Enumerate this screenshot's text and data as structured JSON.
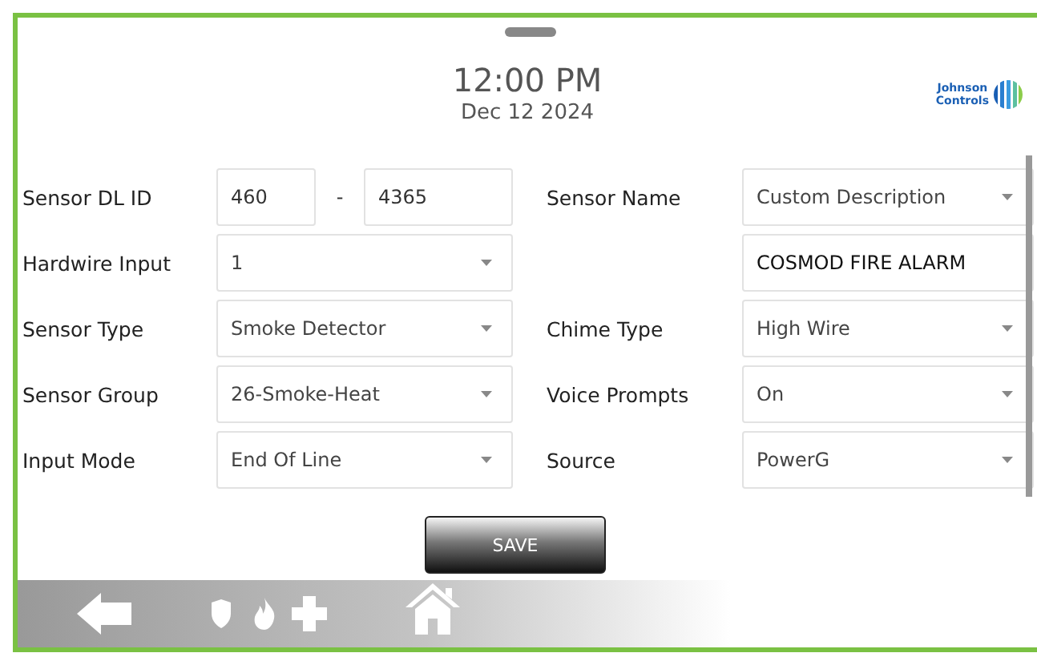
{
  "header": {
    "time": "12:00 PM",
    "date": "Dec 12 2024",
    "logo_text": [
      "Johnson",
      "Controls"
    ]
  },
  "left_rows": [
    {
      "label": "Sensor DL ID",
      "kind": "pair",
      "values": [
        "460",
        "4365"
      ],
      "separator": "-"
    },
    {
      "label": "Hardwire Input",
      "kind": "dropdown",
      "value": "1"
    },
    {
      "label": "Sensor Type",
      "kind": "dropdown",
      "value": "Smoke Detector"
    },
    {
      "label": "Sensor Group",
      "kind": "dropdown",
      "value": "26-Smoke-Heat"
    },
    {
      "label": "Input Mode",
      "kind": "dropdown",
      "value": "End Of Line"
    }
  ],
  "right_rows": [
    {
      "label": "Sensor Name",
      "kind": "dropdown",
      "value": "Custom Description"
    },
    {
      "kind": "text",
      "value": "COSMOD FIRE ALARM"
    },
    {
      "label": "Chime Type",
      "kind": "dropdown",
      "value": "High Wire"
    },
    {
      "label": "Voice Prompts",
      "kind": "dropdown",
      "value": "On"
    },
    {
      "label": "Source",
      "kind": "dropdown",
      "value": "PowerG"
    }
  ],
  "save_button": "SAVE"
}
